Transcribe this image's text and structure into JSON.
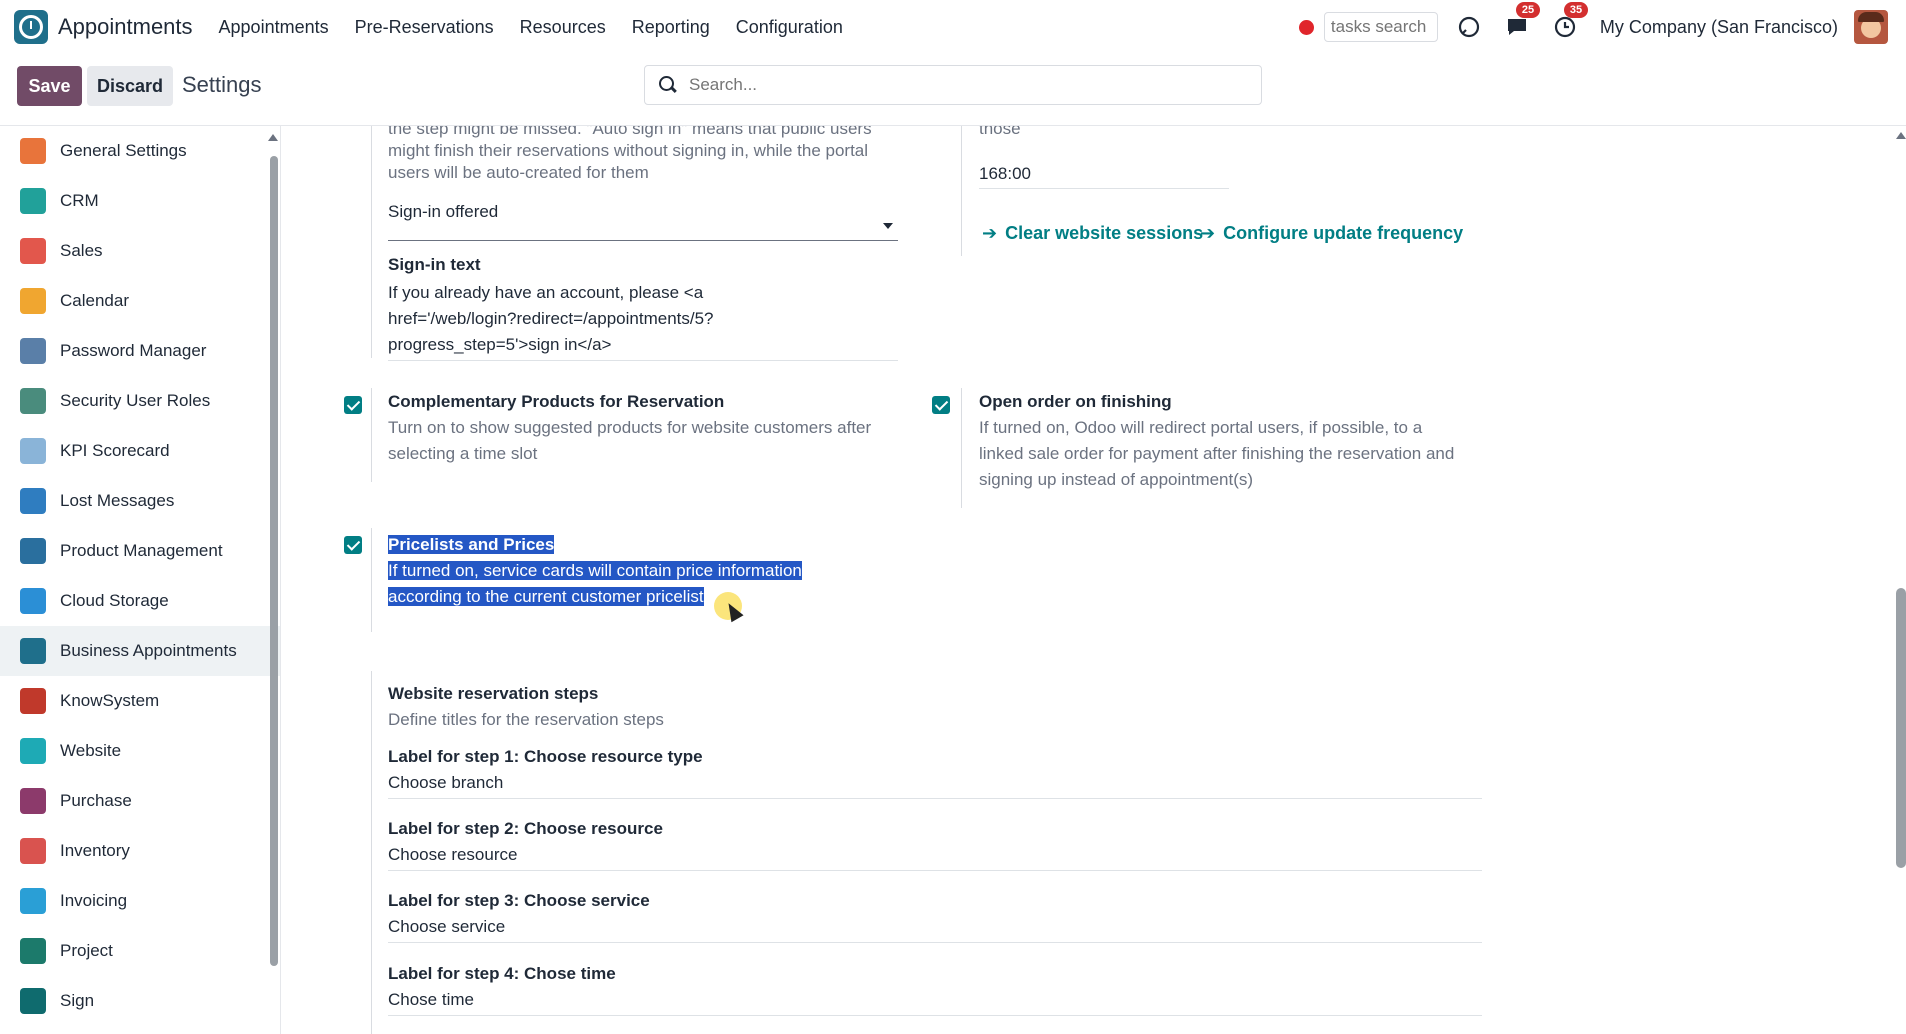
{
  "app": {
    "name": "Appointments"
  },
  "menu": [
    "Appointments",
    "Pre-Reservations",
    "Resources",
    "Reporting",
    "Configuration"
  ],
  "nav": {
    "tasks_search_placeholder": "tasks search",
    "messages_count": "25",
    "activities_count": "35",
    "company": "My Company (San Francisco)"
  },
  "toolbar": {
    "save_label": "Save",
    "discard_label": "Discard",
    "title": "Settings",
    "search_placeholder": "Search..."
  },
  "sidebar": {
    "items": [
      {
        "label": "General Settings",
        "icon": "general-settings-icon",
        "color": "#e8743b"
      },
      {
        "label": "CRM",
        "icon": "crm-icon",
        "color": "#21a19a"
      },
      {
        "label": "Sales",
        "icon": "sales-icon",
        "color": "#e2574c"
      },
      {
        "label": "Calendar",
        "icon": "calendar-icon",
        "color": "#f0a630"
      },
      {
        "label": "Password Manager",
        "icon": "password-manager-icon",
        "color": "#5a7fa8"
      },
      {
        "label": "Security User Roles",
        "icon": "security-roles-icon",
        "color": "#4a8c7d"
      },
      {
        "label": "KPI Scorecard",
        "icon": "kpi-scorecard-icon",
        "color": "#8ab4d8"
      },
      {
        "label": "Lost Messages",
        "icon": "lost-messages-icon",
        "color": "#2f7dc0"
      },
      {
        "label": "Product Management",
        "icon": "product-management-icon",
        "color": "#2a6f9e"
      },
      {
        "label": "Cloud Storage",
        "icon": "cloud-storage-icon",
        "color": "#2b8fd6"
      },
      {
        "label": "Business Appointments",
        "icon": "business-appointments-icon",
        "color": "#1f6f8b"
      },
      {
        "label": "KnowSystem",
        "icon": "knowsystem-icon",
        "color": "#c0392b"
      },
      {
        "label": "Website",
        "icon": "website-icon",
        "color": "#1eaab5"
      },
      {
        "label": "Purchase",
        "icon": "purchase-icon",
        "color": "#8c3a6b"
      },
      {
        "label": "Inventory",
        "icon": "inventory-icon",
        "color": "#d9534f"
      },
      {
        "label": "Invoicing",
        "icon": "invoicing-icon",
        "color": "#2a9fd6"
      },
      {
        "label": "Project",
        "icon": "project-icon",
        "color": "#1c7a6b"
      },
      {
        "label": "Sign",
        "icon": "sign-icon",
        "color": "#0f6b6e"
      }
    ],
    "active_index": 10
  },
  "settings": {
    "signin_desc_line1": "the step might be missed. \"Auto sign in\" means that public users",
    "signin_desc_line2": "might finish their reservations without signing in, while the portal",
    "signin_desc_line3": "users will be auto-created for them",
    "signin_select_value": "Sign-in offered",
    "signin_text_label": "Sign-in text",
    "signin_text_line1": "If you already have an account, please <a",
    "signin_text_line2": "href='/web/login?redirect=/appointments/5?",
    "signin_text_line3": "progress_step=5'>sign in</a>",
    "right_top_text": "those",
    "duration_value": "168:00",
    "link_clear_sessions": "Clear website sessions",
    "link_configure_frequency": "Configure update frequency",
    "complementary_title": "Complementary Products for Reservation",
    "complementary_desc_line1": "Turn on to show suggested products for website customers after",
    "complementary_desc_line2": "selecting a time slot",
    "open_order_title": "Open order on finishing",
    "open_order_desc_line1": "If turned on, Odoo will redirect portal users, if possible, to a",
    "open_order_desc_line2": "linked sale order for payment after finishing the reservation and",
    "open_order_desc_line3": "signing up instead of appointment(s)",
    "pricelists_title": "Pricelists and Prices",
    "pricelists_desc_line1": "If turned on, service cards will contain price information",
    "pricelists_desc_line2": "according to the current customer pricelist",
    "steps_title": "Website reservation steps",
    "steps_desc": "Define titles for the reservation steps",
    "steps": [
      {
        "label": "Label for step 1: Choose resource type",
        "value": "Choose branch"
      },
      {
        "label": "Label for step 2: Choose resource",
        "value": "Choose resource"
      },
      {
        "label": "Label for step 3: Choose service",
        "value": "Choose service"
      },
      {
        "label": "Label for step 4: Chose time",
        "value": "Chose time"
      }
    ]
  },
  "colors": {
    "primary": "#714b67",
    "accent": "#017e84",
    "selection": "#2457c5"
  }
}
